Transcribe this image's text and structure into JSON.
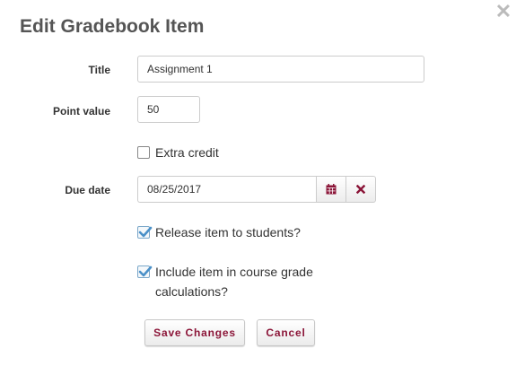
{
  "dialog": {
    "title": "Edit Gradebook Item"
  },
  "form": {
    "title_label": "Title",
    "title_value": "Assignment 1",
    "point_value_label": "Point value",
    "point_value": "50",
    "extra_credit_label": "Extra credit",
    "extra_credit_checked": false,
    "due_date_label": "Due date",
    "due_date_value": "08/25/2017",
    "release_label": "Release item to students?",
    "release_checked": true,
    "include_label_line1": "Include item in course grade",
    "include_label_line2": "calculations?",
    "include_checked": true
  },
  "buttons": {
    "save_label": "Save Changes",
    "cancel_label": "Cancel"
  },
  "icons": {
    "close": "close-icon",
    "calendar": "calendar-icon",
    "clear": "clear-x-icon",
    "check": "checkmark-icon"
  },
  "colors": {
    "accent": "#8b1538",
    "check": "#4a90c8",
    "title": "#555555"
  }
}
